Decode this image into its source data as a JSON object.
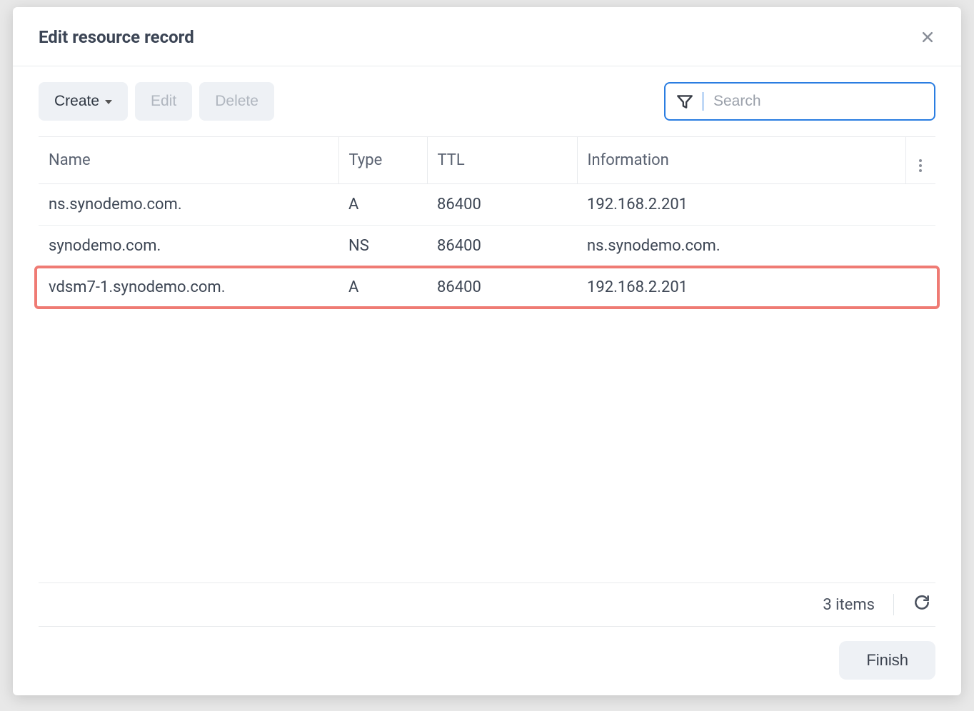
{
  "dialog": {
    "title": "Edit resource record"
  },
  "toolbar": {
    "create_label": "Create",
    "edit_label": "Edit",
    "delete_label": "Delete"
  },
  "search": {
    "placeholder": "Search",
    "value": ""
  },
  "columns": {
    "name": "Name",
    "type": "Type",
    "ttl": "TTL",
    "info": "Information"
  },
  "rows": [
    {
      "name": "ns.synodemo.com.",
      "type": "A",
      "ttl": "86400",
      "info": "192.168.2.201",
      "highlight": false
    },
    {
      "name": "synodemo.com.",
      "type": "NS",
      "ttl": "86400",
      "info": "ns.synodemo.com.",
      "highlight": false
    },
    {
      "name": "vdsm7-1.synodemo.com.",
      "type": "A",
      "ttl": "86400",
      "info": "192.168.2.201",
      "highlight": true
    }
  ],
  "status": {
    "items_label": "3 items"
  },
  "footer": {
    "finish_label": "Finish"
  }
}
